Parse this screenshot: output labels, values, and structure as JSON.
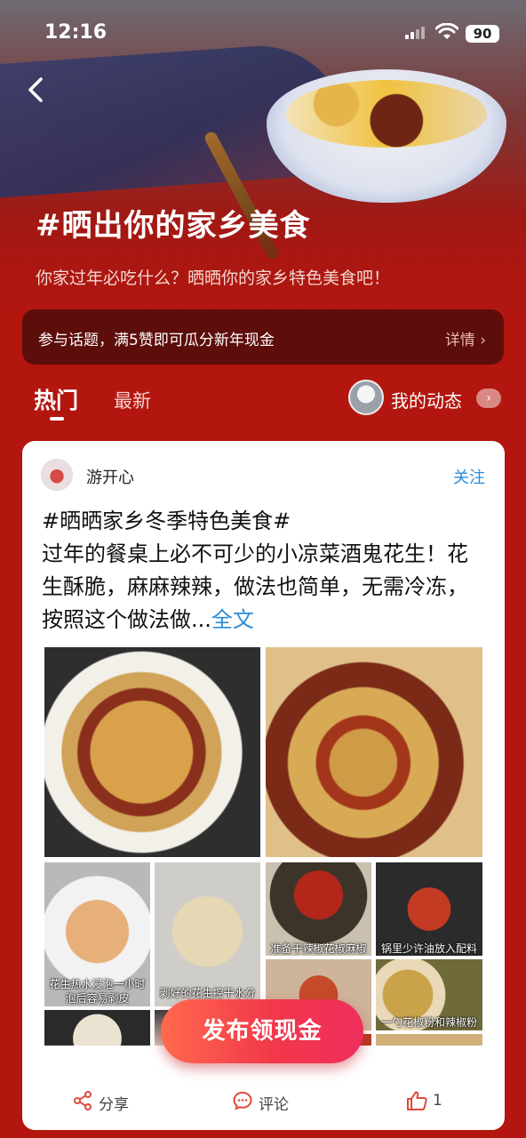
{
  "status_bar": {
    "time": "12:16",
    "battery": "90"
  },
  "topic": {
    "title": "#晒出你的家乡美食",
    "subtitle": "你家过年必吃什么？晒晒你的家乡特色美食吧！",
    "banner_text": "参与话题，满5赞即可瓜分新年现金",
    "banner_more": "详情 ›"
  },
  "tabs": {
    "hot": "热门",
    "latest": "最新",
    "my_dynamic": "我的动态"
  },
  "post": {
    "author": "游开心",
    "follow_label": "关注",
    "text_line1": "#晒晒家乡冬季特色美食#",
    "text_body": "过年的餐桌上必不可少的小凉菜酒鬼花生！花生酥脆，麻麻辣辣，做法也简单，无需冷冻，按照这个做法做...",
    "full_text_link": "全文",
    "photo_captions": {
      "ph3": "花生热水浸泡一小时",
      "ph3b": "泡后容易剥皮",
      "ph4": "剥好的花生控干水分",
      "ph5": "准备干辣椒花椒麻椒",
      "ph6": "锅里少许油放入配料",
      "ph8": "一勺花椒粉和辣椒粉"
    },
    "publish_button": "发布领现金",
    "actions": {
      "share": "分享",
      "comment": "评论",
      "like_count": "1"
    }
  },
  "colors": {
    "page_bg": "#b3160f",
    "link_blue": "#2d8bd6",
    "publish_gradient_start": "#ff6a4d",
    "publish_gradient_end": "#ee2f5c"
  }
}
